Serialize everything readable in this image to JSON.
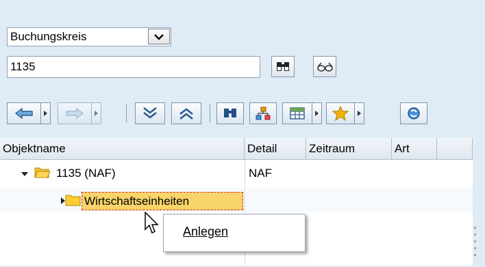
{
  "search": {
    "type_selected": "Buchungskreis",
    "value": "1135"
  },
  "grid": {
    "columns": [
      "Objektname",
      "Detail",
      "Zeitraum",
      "Art"
    ],
    "rows": [
      {
        "name": "1135 (NAF)",
        "detail": "NAF"
      },
      {
        "name": "Wirtschaftseinheiten",
        "detail": ""
      }
    ]
  },
  "context_menu": {
    "items": [
      "Anlegen"
    ]
  },
  "icons": {
    "dropdown": "chevron-down-icon",
    "search": "binoculars-icon",
    "hierarchy_search": "glasses-icon",
    "back": "arrow-left-icon",
    "forward": "arrow-right-icon",
    "expand_all": "expand-all-icon",
    "collapse_all": "collapse-all-icon",
    "find": "find-icon",
    "hierarchy": "hierarchy-icon",
    "layout": "table-layout-icon",
    "favorites": "star-icon",
    "refresh": "refresh-icon",
    "folder": "folder-icon"
  }
}
